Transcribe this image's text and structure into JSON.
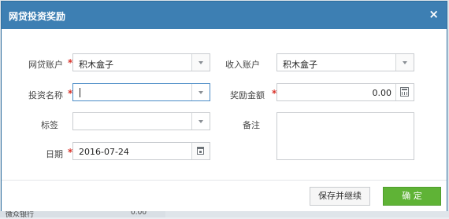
{
  "dialog": {
    "title": "网贷投资奖励",
    "close_symbol": "×"
  },
  "form": {
    "loan_account": {
      "label": "网贷账户",
      "value": "积木盒子"
    },
    "income_account": {
      "label": "收入账户",
      "value": "积木盒子"
    },
    "investment_name": {
      "label": "投资名称",
      "value": ""
    },
    "reward_amount": {
      "label": "奖励金额",
      "value": "0.00"
    },
    "tag": {
      "label": "标签",
      "value": ""
    },
    "note": {
      "label": "备注",
      "value": ""
    },
    "date": {
      "label": "日期",
      "value": "2016-07-24"
    },
    "required_mark": "*"
  },
  "buttons": {
    "save_continue": "保存并继续",
    "confirm": "确 定"
  },
  "background": {
    "row_label": "微众银行",
    "row_value": "0.00"
  },
  "colors": {
    "title_bar": "#3d7fb3",
    "primary_button": "#5fb336",
    "required": "#d9342b"
  }
}
